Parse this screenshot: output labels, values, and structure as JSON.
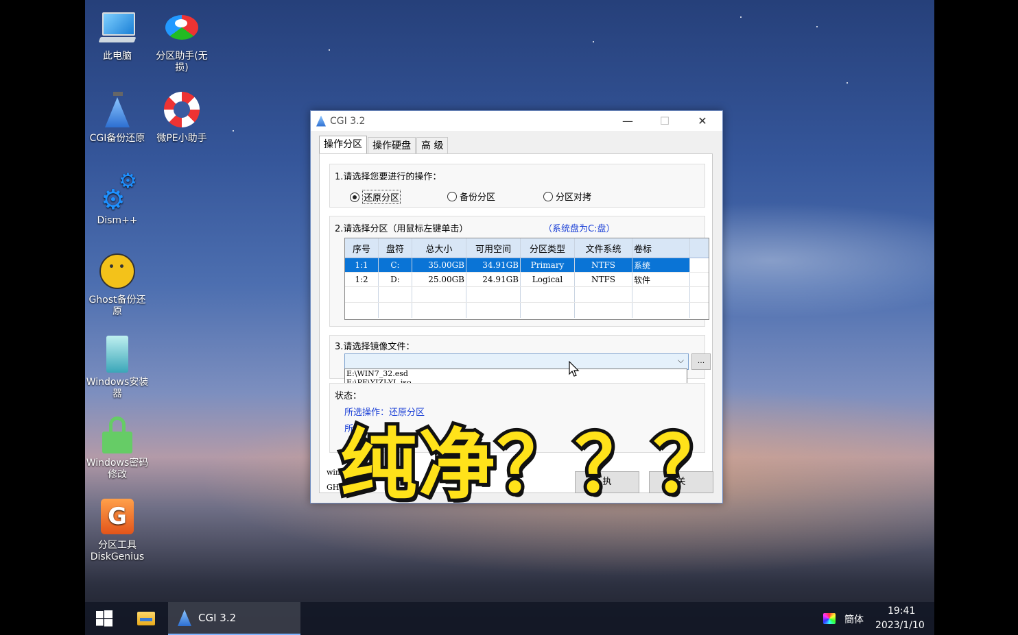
{
  "desktop": {
    "icons": [
      {
        "label": "此电脑"
      },
      {
        "label": "分区助手(无损)"
      },
      {
        "label": "CGI备份还原"
      },
      {
        "label": "微PE小助手"
      },
      {
        "label": "Dism++"
      },
      {
        "label": "Ghost备份还原"
      },
      {
        "label": "Windows安装器"
      },
      {
        "label": "Windows密码修改"
      },
      {
        "label": "分区工具DiskGenius"
      }
    ]
  },
  "window": {
    "title": "CGI 3.2",
    "minimize": "—",
    "maximize": "☐",
    "close": "✕",
    "tabs": [
      "操作分区",
      "操作硬盘",
      "高 级"
    ],
    "section1": {
      "title": "1.请选择您要进行的操作：",
      "options": [
        "还原分区",
        "备份分区",
        "分区对拷"
      ],
      "selected": "还原分区"
    },
    "section2": {
      "title": "2.请选择分区（用鼠标左键单击）",
      "hint": "（系统盘为C:盘）",
      "columns": [
        "序号",
        "盘符",
        "总大小",
        "可用空间",
        "分区类型",
        "文件系统",
        "卷标"
      ],
      "rows": [
        [
          "1:1",
          "C:",
          "35.00GB",
          "34.91GB",
          "Primary",
          "NTFS",
          "系统"
        ],
        [
          "1:2",
          "D:",
          "25.00GB",
          "24.91GB",
          "Logical",
          "NTFS",
          "软件"
        ]
      ]
    },
    "section3": {
      "title": "3.请选择镜像文件：",
      "combo_value": "",
      "browse": "...",
      "dropdown": [
        "E:\\WIN7_32.esd",
        "E:\\PE\\YJZJ-YL.iso"
      ]
    },
    "status": {
      "title": "状态：",
      "line1": "所选操作：还原分区",
      "line2": "所"
    },
    "footer": {
      "line1": "wim",
      "line2": "GHO"
    },
    "buttons": {
      "execute": "执",
      "close": "关"
    }
  },
  "caption": "纯净？？？",
  "taskbar": {
    "app": "CGI 3.2",
    "ime": "簡体",
    "time": "19:41",
    "date": "2023/1/10"
  },
  "colors": {
    "accent": "#0a74d6",
    "caption": "#ffe21a",
    "hint": "#1a3fd6"
  }
}
